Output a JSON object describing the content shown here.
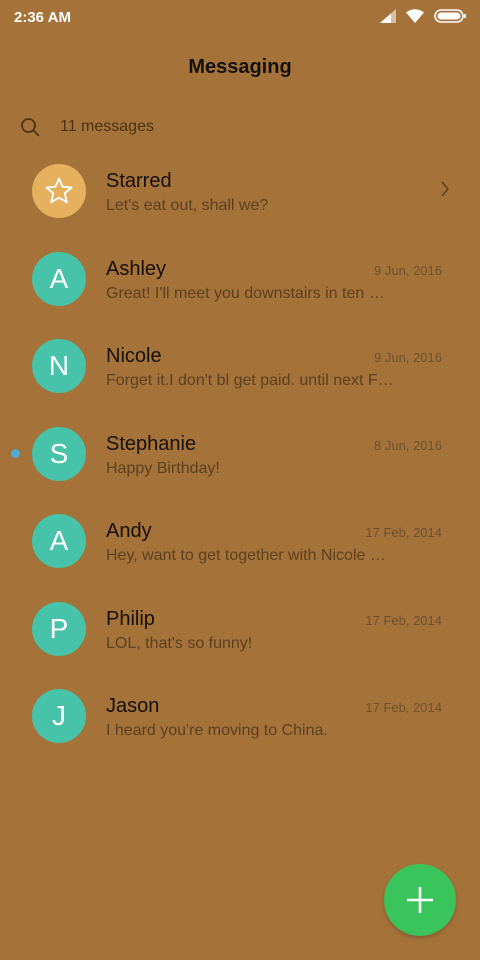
{
  "status_bar": {
    "time": "2:36 AM",
    "icons": [
      "signal-icon",
      "wifi-icon",
      "battery-icon"
    ]
  },
  "header": {
    "title": "Messaging"
  },
  "search": {
    "count_text": "11 messages"
  },
  "conversations": [
    {
      "name": "Starred",
      "preview": "Let's eat out, shall we?",
      "date": "",
      "avatar": "",
      "unread": false,
      "starred": true
    },
    {
      "name": "Ashley",
      "preview": "Great! I'll meet you downstairs in ten …",
      "date": "9 Jun, 2016",
      "avatar": "A",
      "unread": false
    },
    {
      "name": "Nicole",
      "preview": "Forget it.I don't bl get paid. until next F…",
      "date": "9 Jun, 2016",
      "avatar": "N",
      "unread": false
    },
    {
      "name": "Stephanie",
      "preview": "Happy Birthday!",
      "date": "8 Jun, 2016",
      "avatar": "S",
      "unread": true
    },
    {
      "name": "Andy",
      "preview": "Hey, want to get together with Nicole …",
      "date": "17 Feb, 2014",
      "avatar": "A",
      "unread": false
    },
    {
      "name": "Philip",
      "preview": "LOL, that's so funny!",
      "date": "17 Feb, 2014",
      "avatar": "P",
      "unread": false
    },
    {
      "name": "Jason",
      "preview": "I heard you're moving to China.",
      "date": "17 Feb, 2014",
      "avatar": "J",
      "unread": false
    }
  ],
  "colors": {
    "background": "#a5723a",
    "avatar": "#46c3a8",
    "starred_avatar": "#e5b15f",
    "fab": "#3ac55c",
    "unread_dot": "#4dabd5"
  },
  "fab": {
    "icon": "plus-icon"
  }
}
